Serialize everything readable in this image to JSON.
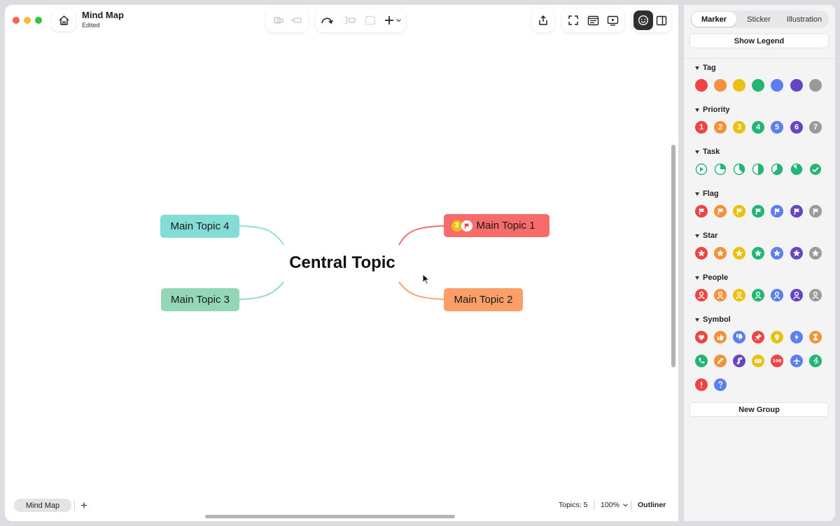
{
  "window": {
    "title": "Mind Map",
    "status": "Edited"
  },
  "map": {
    "central": "Central Topic",
    "topics": [
      {
        "label": "Main Topic 1",
        "color": "#f76b6b",
        "markers": [
          "priority-3",
          "flag"
        ]
      },
      {
        "label": "Main Topic 2",
        "color": "#fb9e67"
      },
      {
        "label": "Main Topic 3",
        "color": "#93d6b8"
      },
      {
        "label": "Main Topic 4",
        "color": "#83ddd6"
      }
    ],
    "marker_values": {
      "priority": "3"
    }
  },
  "footer": {
    "sheet_tab": "Mind Map",
    "add_sheet": "+",
    "topics_count": "Topics: 5",
    "zoom": "100%",
    "outliner": "Outliner"
  },
  "panel": {
    "tabs": [
      "Marker",
      "Sticker",
      "Illustration"
    ],
    "active_tab": "Marker",
    "show_legend": "Show Legend",
    "new_group": "New Group",
    "palette": [
      "#ef4444",
      "#f6913a",
      "#ebc10e",
      "#22b573",
      "#5b7ff0",
      "#6644c4",
      "#9a9a9a"
    ],
    "sections": [
      {
        "title": "Tag"
      },
      {
        "title": "Priority",
        "labels": [
          "1",
          "2",
          "3",
          "4",
          "5",
          "6",
          "7"
        ]
      },
      {
        "title": "Task"
      },
      {
        "title": "Flag"
      },
      {
        "title": "Star"
      },
      {
        "title": "People"
      },
      {
        "title": "Symbol"
      }
    ]
  }
}
